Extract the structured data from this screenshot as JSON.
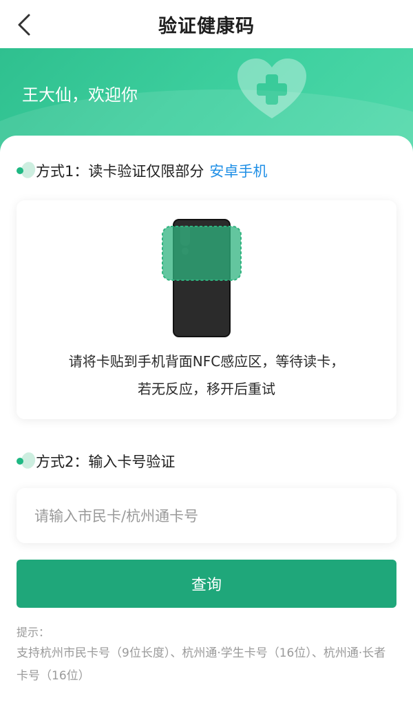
{
  "nav": {
    "title": "验证健康码",
    "back_icon": "chevron-left-icon"
  },
  "banner": {
    "greeting": "王大仙，欢迎你",
    "deco_icon": "heart-plus-icon"
  },
  "method1": {
    "title": "方式1：读卡验证仅限部分",
    "link": "安卓手机",
    "instruction_line1": "请将卡贴到手机背面NFC感应区，等待读卡，",
    "instruction_line2": "若无反应，移开后重试",
    "illustration_icon": "phone-nfc-icon"
  },
  "method2": {
    "title": "方式2：输入卡号验证",
    "input_placeholder": "请输入市民卡/杭州通卡号",
    "button_label": "查询"
  },
  "hint": {
    "label": "提示：",
    "text": "支持杭州市民卡号（9位长度）、杭州通·学生卡号（16位）、杭州通·长者卡号（16位）"
  },
  "colors": {
    "brand_green": "#1fa77a",
    "banner_green": "#3fd1a0",
    "link_blue": "#1f8fe6",
    "hint_gray": "#9a9a9a"
  }
}
